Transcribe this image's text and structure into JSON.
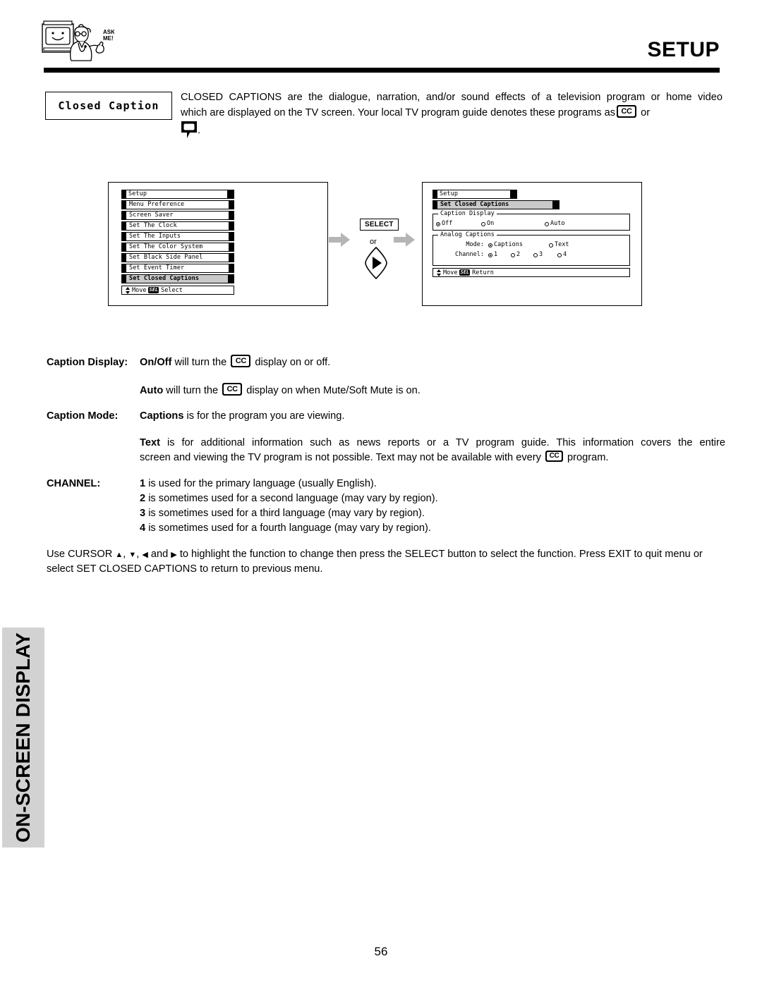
{
  "header": {
    "title": "SETUP",
    "mascot_alt": "ask-me-mascot",
    "mascot_text_line1": "ASK",
    "mascot_text_line2": "ME!"
  },
  "intro": {
    "label": "Closed Caption",
    "line1": "CLOSED CAPTIONS are the dialogue, narration, and/or sound effects of a television program or home video",
    "line2_a": "which are displayed on the TV screen.  Your local TV program guide denotes these programs as",
    "line2_b": "or",
    "line3": "."
  },
  "diagram": {
    "left_menu": {
      "title": "Setup",
      "items": [
        "Menu Preference",
        "Screen Saver",
        "Set The Clock",
        "Set The Inputs",
        "Set The Color System",
        "Set Black Side Panel",
        "Set Event Timer",
        "Set Closed Captions"
      ],
      "selected_index": 7,
      "footer_move": "Move",
      "footer_key": "SEL",
      "footer_action": "Select"
    },
    "transition": {
      "select_key": "SELECT",
      "or_label": "or",
      "right_key_icon": "right-arrow-key-icon"
    },
    "right_menu": {
      "title": "Setup",
      "dropdown": "Set Closed Captions",
      "caption_display": {
        "legend": "Caption Display",
        "options": [
          {
            "label": "Off",
            "selected": true
          },
          {
            "label": "On",
            "selected": false
          },
          {
            "label": "Auto",
            "selected": false
          }
        ]
      },
      "analog_captions": {
        "legend": "Analog Captions",
        "mode_label": "Mode:",
        "mode_options": [
          {
            "label": "Captions",
            "selected": true
          },
          {
            "label": "Text",
            "selected": false
          }
        ],
        "channel_label": "Channel:",
        "channel_options": [
          {
            "label": "1",
            "selected": true
          },
          {
            "label": "2",
            "selected": false
          },
          {
            "label": "3",
            "selected": false
          },
          {
            "label": "4",
            "selected": false
          }
        ]
      },
      "footer_move": "Move",
      "footer_key": "SEL",
      "footer_action": "Return"
    }
  },
  "body": {
    "caption_display_label": "Caption Display:",
    "caption_display_bold": "On/Off",
    "caption_display_mid": "will turn the",
    "caption_display_end": "display on or off.",
    "auto_bold": "Auto",
    "auto_mid": "will turn the",
    "auto_end": "display on when Mute/Soft Mute is on.",
    "caption_mode_label": "Caption Mode:",
    "caption_mode_bold": "Captions",
    "caption_mode_rest": "is for the program you are viewing.",
    "text_bold": "Text",
    "text_line1": "is for additional information such as news reports or a TV program guide.  This information covers the entire",
    "text_line2_a": "screen and viewing the TV program is not possible.  Text may not be available with every",
    "text_line2_b": "program.",
    "channel_label": "CHANNEL:",
    "channels": [
      {
        "num": "1",
        "desc": "is used for the primary language (usually English)."
      },
      {
        "num": "2",
        "desc": "is sometimes used for a second language (may vary by region)."
      },
      {
        "num": "3",
        "desc": "is sometimes used for a third language (may vary by region)."
      },
      {
        "num": "4",
        "desc": "is sometimes used for a fourth language (may vary by region)."
      }
    ],
    "closing_line1_a": "Use CURSOR",
    "closing_line1_b": ",",
    "closing_line1_c": ",",
    "closing_line1_d": "and",
    "closing_line1_e": "to highlight the function to change then press the SELECT button to select the function.",
    "closing_line2": "Press EXIT to quit menu or select SET CLOSED CAPTIONS to return to previous menu."
  },
  "side_tab": {
    "label": "ON-SCREEN DISPLAY",
    "background": "#d2d2d2"
  },
  "footer": {
    "page_number": "56"
  }
}
